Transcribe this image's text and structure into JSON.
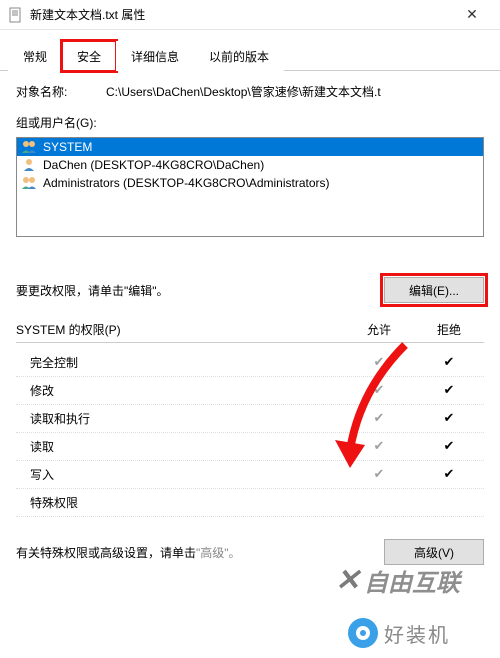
{
  "window": {
    "title": "新建文本文档.txt 属性",
    "close": "✕"
  },
  "tabs": {
    "general": "常规",
    "security": "安全",
    "details": "详细信息",
    "previous": "以前的版本"
  },
  "object": {
    "label": "对象名称:",
    "path": "C:\\Users\\DaChen\\Desktop\\管家速修\\新建文本文档.t"
  },
  "groups": {
    "label": "组或用户名(G):",
    "items": [
      {
        "name": "SYSTEM"
      },
      {
        "name": "DaChen (DESKTOP-4KG8CRO\\DaChen)"
      },
      {
        "name": "Administrators (DESKTOP-4KG8CRO\\Administrators)"
      }
    ]
  },
  "editRow": {
    "label": "要更改权限，请单击\"编辑\"。",
    "button": "编辑(E)..."
  },
  "perms": {
    "title": "SYSTEM 的权限(P)",
    "allow": "允许",
    "deny": "拒绝",
    "rows": [
      {
        "name": "完全控制",
        "allow": true,
        "deny": true
      },
      {
        "name": "修改",
        "allow": true,
        "deny": true
      },
      {
        "name": "读取和执行",
        "allow": true,
        "deny": true
      },
      {
        "name": "读取",
        "allow": true,
        "deny": true
      },
      {
        "name": "写入",
        "allow": true,
        "deny": true
      },
      {
        "name": "特殊权限",
        "allow": false,
        "deny": false
      }
    ]
  },
  "advanced": {
    "prefix": "有关特殊权限或高级设置，请单击",
    "gray": "\"高级\"。",
    "button": "高级(V)"
  },
  "watermark": {
    "brand1": "自由互联",
    "brand2": "好装机"
  }
}
